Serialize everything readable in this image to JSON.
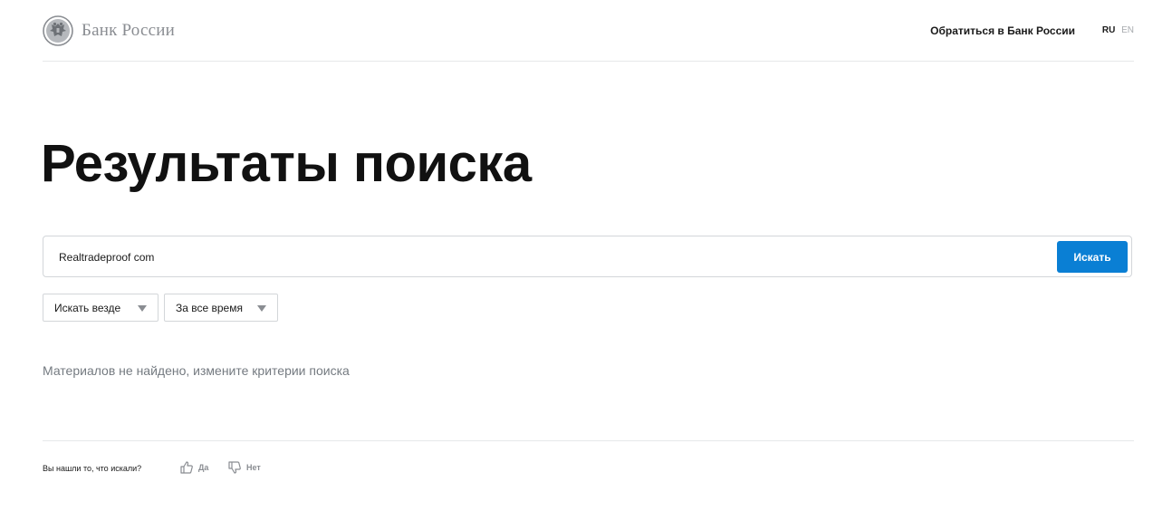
{
  "header": {
    "logo_text": "Банк России",
    "logo_icon": "double-headed-eagle-emblem",
    "contact_link": "Обратиться в Банк России",
    "lang_ru": "RU",
    "lang_en": "EN"
  },
  "main": {
    "title": "Результаты поиска",
    "search": {
      "value": "Realtradeproof com",
      "button_label": "Искать"
    },
    "filters": {
      "scope_label": "Искать везде",
      "period_label": "За все время"
    },
    "no_results_text": "Материалов не найдено, измените критерии поиска"
  },
  "feedback": {
    "question": "Вы нашли то, что искали?",
    "yes_label": "Да",
    "no_label": "Нет",
    "yes_icon": "thumbs-up-icon",
    "no_icon": "thumbs-down-icon"
  },
  "colors": {
    "accent": "#0a7fd4",
    "muted_text": "#747a80",
    "border": "#d3d6d9"
  }
}
